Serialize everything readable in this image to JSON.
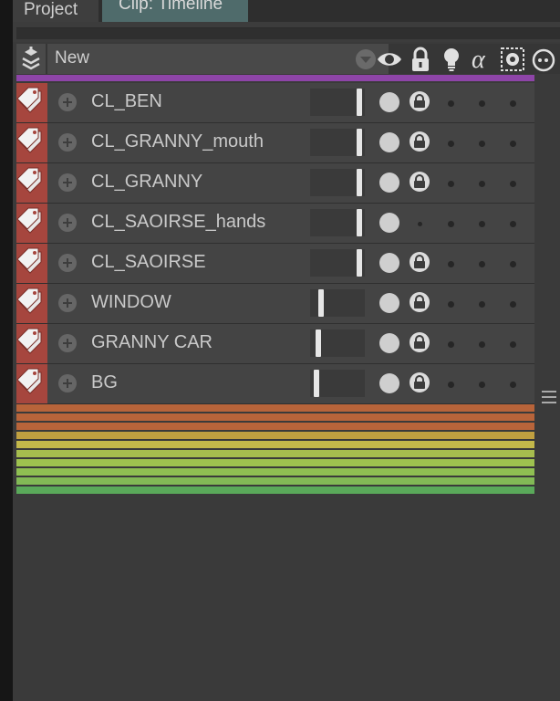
{
  "tabs": [
    {
      "label": "Project"
    },
    {
      "label": "Clip: Timeline"
    }
  ],
  "toolbar": {
    "select_value": "New",
    "column_icons": [
      "visibility-eye-icon",
      "lock-icon",
      "light-bulb-icon",
      "alpha-icon",
      "mask-icon",
      "camera-icon"
    ]
  },
  "colors": {
    "purple_bar": "#8e45a8",
    "tag_red": "#a6463e",
    "bands": [
      "#b8643a",
      "#b8643a",
      "#b8643a",
      "#c0a040",
      "#c3b84a",
      "#a6bd4e",
      "#9ec24f",
      "#8fbf52",
      "#82b956",
      "#5aa95a"
    ]
  },
  "layers": [
    {
      "name": "CL_BEN",
      "opacity": 0.95,
      "locked": true
    },
    {
      "name": "CL_GRANNY_mouth",
      "opacity": 0.95,
      "locked": true
    },
    {
      "name": "CL_GRANNY",
      "opacity": 0.95,
      "locked": true
    },
    {
      "name": "CL_SAOIRSE_hands",
      "opacity": 0.95,
      "locked": false
    },
    {
      "name": "CL_SAOIRSE",
      "opacity": 0.95,
      "locked": true
    },
    {
      "name": "WINDOW",
      "opacity": 0.15,
      "locked": true
    },
    {
      "name": "GRANNY CAR",
      "opacity": 0.1,
      "locked": true
    },
    {
      "name": "BG",
      "opacity": 0.05,
      "locked": true
    }
  ]
}
